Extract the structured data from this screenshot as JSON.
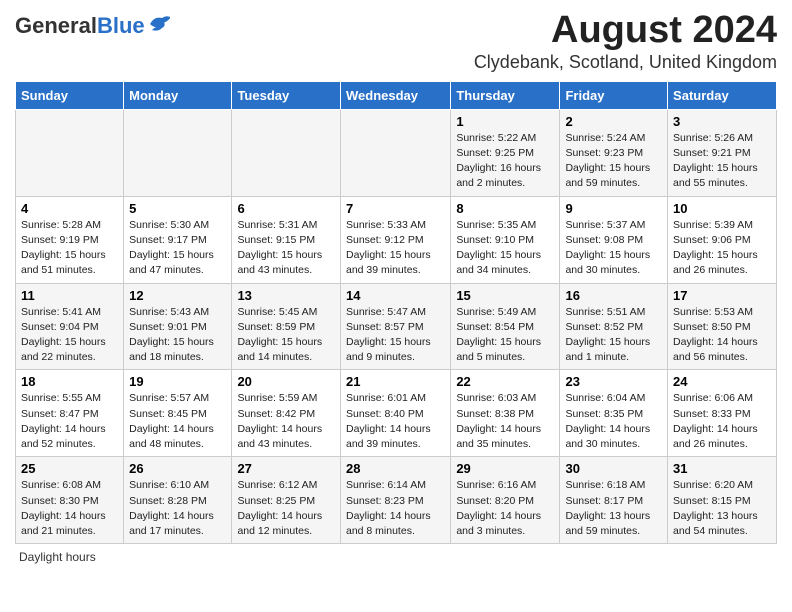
{
  "header": {
    "logo_general": "General",
    "logo_blue": "Blue",
    "title": "August 2024",
    "subtitle": "Clydebank, Scotland, United Kingdom"
  },
  "days_of_week": [
    "Sunday",
    "Monday",
    "Tuesday",
    "Wednesday",
    "Thursday",
    "Friday",
    "Saturday"
  ],
  "weeks": [
    [
      {
        "num": "",
        "info": ""
      },
      {
        "num": "",
        "info": ""
      },
      {
        "num": "",
        "info": ""
      },
      {
        "num": "",
        "info": ""
      },
      {
        "num": "1",
        "info": "Sunrise: 5:22 AM\nSunset: 9:25 PM\nDaylight: 16 hours\nand 2 minutes."
      },
      {
        "num": "2",
        "info": "Sunrise: 5:24 AM\nSunset: 9:23 PM\nDaylight: 15 hours\nand 59 minutes."
      },
      {
        "num": "3",
        "info": "Sunrise: 5:26 AM\nSunset: 9:21 PM\nDaylight: 15 hours\nand 55 minutes."
      }
    ],
    [
      {
        "num": "4",
        "info": "Sunrise: 5:28 AM\nSunset: 9:19 PM\nDaylight: 15 hours\nand 51 minutes."
      },
      {
        "num": "5",
        "info": "Sunrise: 5:30 AM\nSunset: 9:17 PM\nDaylight: 15 hours\nand 47 minutes."
      },
      {
        "num": "6",
        "info": "Sunrise: 5:31 AM\nSunset: 9:15 PM\nDaylight: 15 hours\nand 43 minutes."
      },
      {
        "num": "7",
        "info": "Sunrise: 5:33 AM\nSunset: 9:12 PM\nDaylight: 15 hours\nand 39 minutes."
      },
      {
        "num": "8",
        "info": "Sunrise: 5:35 AM\nSunset: 9:10 PM\nDaylight: 15 hours\nand 34 minutes."
      },
      {
        "num": "9",
        "info": "Sunrise: 5:37 AM\nSunset: 9:08 PM\nDaylight: 15 hours\nand 30 minutes."
      },
      {
        "num": "10",
        "info": "Sunrise: 5:39 AM\nSunset: 9:06 PM\nDaylight: 15 hours\nand 26 minutes."
      }
    ],
    [
      {
        "num": "11",
        "info": "Sunrise: 5:41 AM\nSunset: 9:04 PM\nDaylight: 15 hours\nand 22 minutes."
      },
      {
        "num": "12",
        "info": "Sunrise: 5:43 AM\nSunset: 9:01 PM\nDaylight: 15 hours\nand 18 minutes."
      },
      {
        "num": "13",
        "info": "Sunrise: 5:45 AM\nSunset: 8:59 PM\nDaylight: 15 hours\nand 14 minutes."
      },
      {
        "num": "14",
        "info": "Sunrise: 5:47 AM\nSunset: 8:57 PM\nDaylight: 15 hours\nand 9 minutes."
      },
      {
        "num": "15",
        "info": "Sunrise: 5:49 AM\nSunset: 8:54 PM\nDaylight: 15 hours\nand 5 minutes."
      },
      {
        "num": "16",
        "info": "Sunrise: 5:51 AM\nSunset: 8:52 PM\nDaylight: 15 hours\nand 1 minute."
      },
      {
        "num": "17",
        "info": "Sunrise: 5:53 AM\nSunset: 8:50 PM\nDaylight: 14 hours\nand 56 minutes."
      }
    ],
    [
      {
        "num": "18",
        "info": "Sunrise: 5:55 AM\nSunset: 8:47 PM\nDaylight: 14 hours\nand 52 minutes."
      },
      {
        "num": "19",
        "info": "Sunrise: 5:57 AM\nSunset: 8:45 PM\nDaylight: 14 hours\nand 48 minutes."
      },
      {
        "num": "20",
        "info": "Sunrise: 5:59 AM\nSunset: 8:42 PM\nDaylight: 14 hours\nand 43 minutes."
      },
      {
        "num": "21",
        "info": "Sunrise: 6:01 AM\nSunset: 8:40 PM\nDaylight: 14 hours\nand 39 minutes."
      },
      {
        "num": "22",
        "info": "Sunrise: 6:03 AM\nSunset: 8:38 PM\nDaylight: 14 hours\nand 35 minutes."
      },
      {
        "num": "23",
        "info": "Sunrise: 6:04 AM\nSunset: 8:35 PM\nDaylight: 14 hours\nand 30 minutes."
      },
      {
        "num": "24",
        "info": "Sunrise: 6:06 AM\nSunset: 8:33 PM\nDaylight: 14 hours\nand 26 minutes."
      }
    ],
    [
      {
        "num": "25",
        "info": "Sunrise: 6:08 AM\nSunset: 8:30 PM\nDaylight: 14 hours\nand 21 minutes."
      },
      {
        "num": "26",
        "info": "Sunrise: 6:10 AM\nSunset: 8:28 PM\nDaylight: 14 hours\nand 17 minutes."
      },
      {
        "num": "27",
        "info": "Sunrise: 6:12 AM\nSunset: 8:25 PM\nDaylight: 14 hours\nand 12 minutes."
      },
      {
        "num": "28",
        "info": "Sunrise: 6:14 AM\nSunset: 8:23 PM\nDaylight: 14 hours\nand 8 minutes."
      },
      {
        "num": "29",
        "info": "Sunrise: 6:16 AM\nSunset: 8:20 PM\nDaylight: 14 hours\nand 3 minutes."
      },
      {
        "num": "30",
        "info": "Sunrise: 6:18 AM\nSunset: 8:17 PM\nDaylight: 13 hours\nand 59 minutes."
      },
      {
        "num": "31",
        "info": "Sunrise: 6:20 AM\nSunset: 8:15 PM\nDaylight: 13 hours\nand 54 minutes."
      }
    ]
  ],
  "footer": {
    "daylight_hours_label": "Daylight hours"
  },
  "colors": {
    "header_bg": "#2970c8",
    "accent": "#2970c8"
  }
}
